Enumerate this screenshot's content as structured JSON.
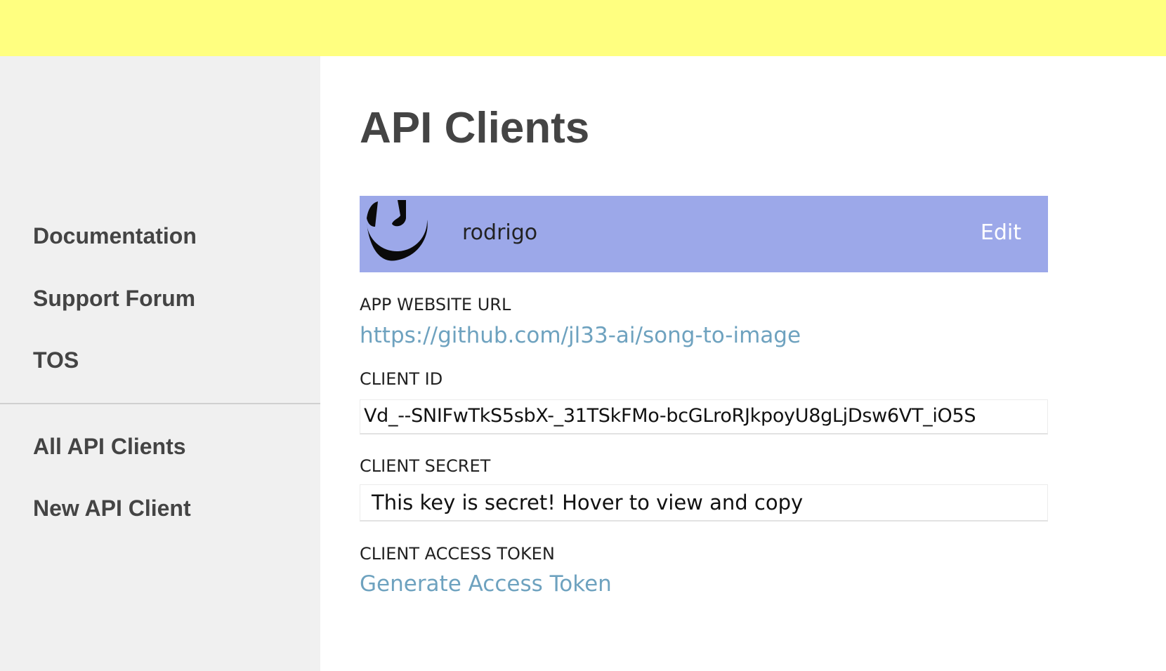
{
  "colors": {
    "banner": "#ffff80",
    "sidebar": "#f0f0f0",
    "card": "#9ca8e9",
    "link": "#6ea2bf"
  },
  "sidebar": {
    "links": [
      "Documentation",
      "Support Forum",
      "TOS"
    ],
    "client_links": [
      "All API Clients",
      "New API Client"
    ]
  },
  "main": {
    "title": "API Clients",
    "client": {
      "avatar_icon": "genius-logo-icon",
      "name": "rodrigo",
      "edit_label": "Edit"
    },
    "fields": {
      "app_website_url_label": "APP WEBSITE URL",
      "app_website_url": "https://github.com/jl33-ai/song-to-image",
      "client_id_label": "CLIENT ID",
      "client_id": "Vd_--SNIFwTkS5sbX-_31TSkFMo-bcGLroRJkpoyU8gLjDsw6VT_iO5S",
      "client_secret_label": "CLIENT SECRET",
      "client_secret_hint": "This key is secret! Hover to view and copy",
      "client_access_token_label": "CLIENT ACCESS TOKEN",
      "generate_token_label": "Generate Access Token"
    }
  }
}
